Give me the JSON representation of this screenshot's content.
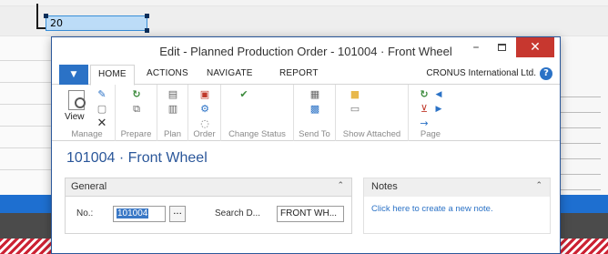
{
  "background": {
    "selected_cell_value": "20",
    "accent_blue": "#1e6fd0",
    "hatch_red": "#cc2233"
  },
  "dialog": {
    "title": "Edit - Planned Production Order - 101004 · Front Wheel",
    "window_buttons": {
      "minimize": "–",
      "close": "✕"
    }
  },
  "ribbon_tabs": {
    "file_icon": "▼",
    "tabs": [
      "HOME",
      "ACTIONS",
      "NAVIGATE",
      "REPORT"
    ],
    "company": "CRONUS International Ltd.",
    "help": "?"
  },
  "ribbon": {
    "view_label": "View",
    "groups": [
      "Manage",
      "Prepare",
      "Plan",
      "Order",
      "Change Status",
      "Send To",
      "Show Attached",
      "Page"
    ]
  },
  "record": {
    "title": "101004 · Front Wheel"
  },
  "general": {
    "header": "General",
    "no_label": "No.:",
    "no_value": "101004",
    "dots": "...",
    "search_label": "Search D...",
    "search_value": "FRONT WH..."
  },
  "notes": {
    "header": "Notes",
    "link": "Click here to create a new note."
  },
  "icons": {
    "chevron_up": "⌃",
    "refresh": "↻",
    "nav_left": "◀",
    "nav_right": "▶",
    "arrow_right": "→"
  },
  "colors": {
    "brand": "#2b72c6",
    "title_blue": "#2b579a",
    "close_red": "#c7372f",
    "refresh_green": "#3b8a3b"
  }
}
